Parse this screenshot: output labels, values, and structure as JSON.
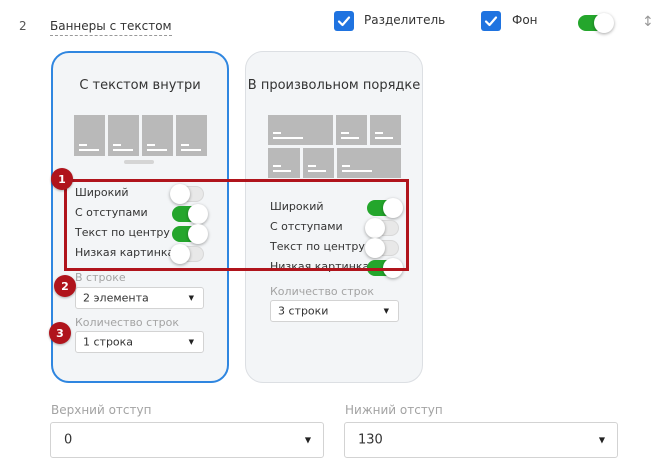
{
  "row": {
    "number": "2",
    "title": "Баннеры с текстом"
  },
  "header_options": {
    "divider_label": "Разделитель",
    "divider_checked": true,
    "background_label": "Фон",
    "background_checked": true,
    "visibility_toggle_on": true,
    "resize_icon": "vertical-resize-icon"
  },
  "cards": [
    {
      "title": "С текстом внутри",
      "selected": true,
      "options": [
        {
          "label": "Широкий",
          "on": false
        },
        {
          "label": "С отступами",
          "on": true
        },
        {
          "label": "Текст по центру",
          "on": true
        },
        {
          "label": "Низкая картинка",
          "on": false
        }
      ],
      "per_row_label": "В строке",
      "per_row_value": "2 элемента",
      "rows_count_label": "Количество строк",
      "rows_count_value": "1 строка"
    },
    {
      "title": "В произвольном порядке",
      "selected": false,
      "options": [
        {
          "label": "Широкий",
          "on": true
        },
        {
          "label": "С отступами",
          "on": false
        },
        {
          "label": "Текст по центру",
          "on": false
        },
        {
          "label": "Низкая картинка",
          "on": true
        }
      ],
      "rows_count_label": "Количество строк",
      "rows_count_value": "3 строки"
    }
  ],
  "margins": {
    "top_label": "Верхний отступ",
    "top_value": "0",
    "bottom_label": "Нижний отступ",
    "bottom_value": "130"
  },
  "annotations": {
    "badge1": "1",
    "badge2": "2",
    "badge3": "3"
  },
  "colors": {
    "accent_blue": "#1f73e0",
    "toggle_on": "#24a62c",
    "annotation_red": "#b0141c",
    "card_bg": "#f3f5f7"
  }
}
